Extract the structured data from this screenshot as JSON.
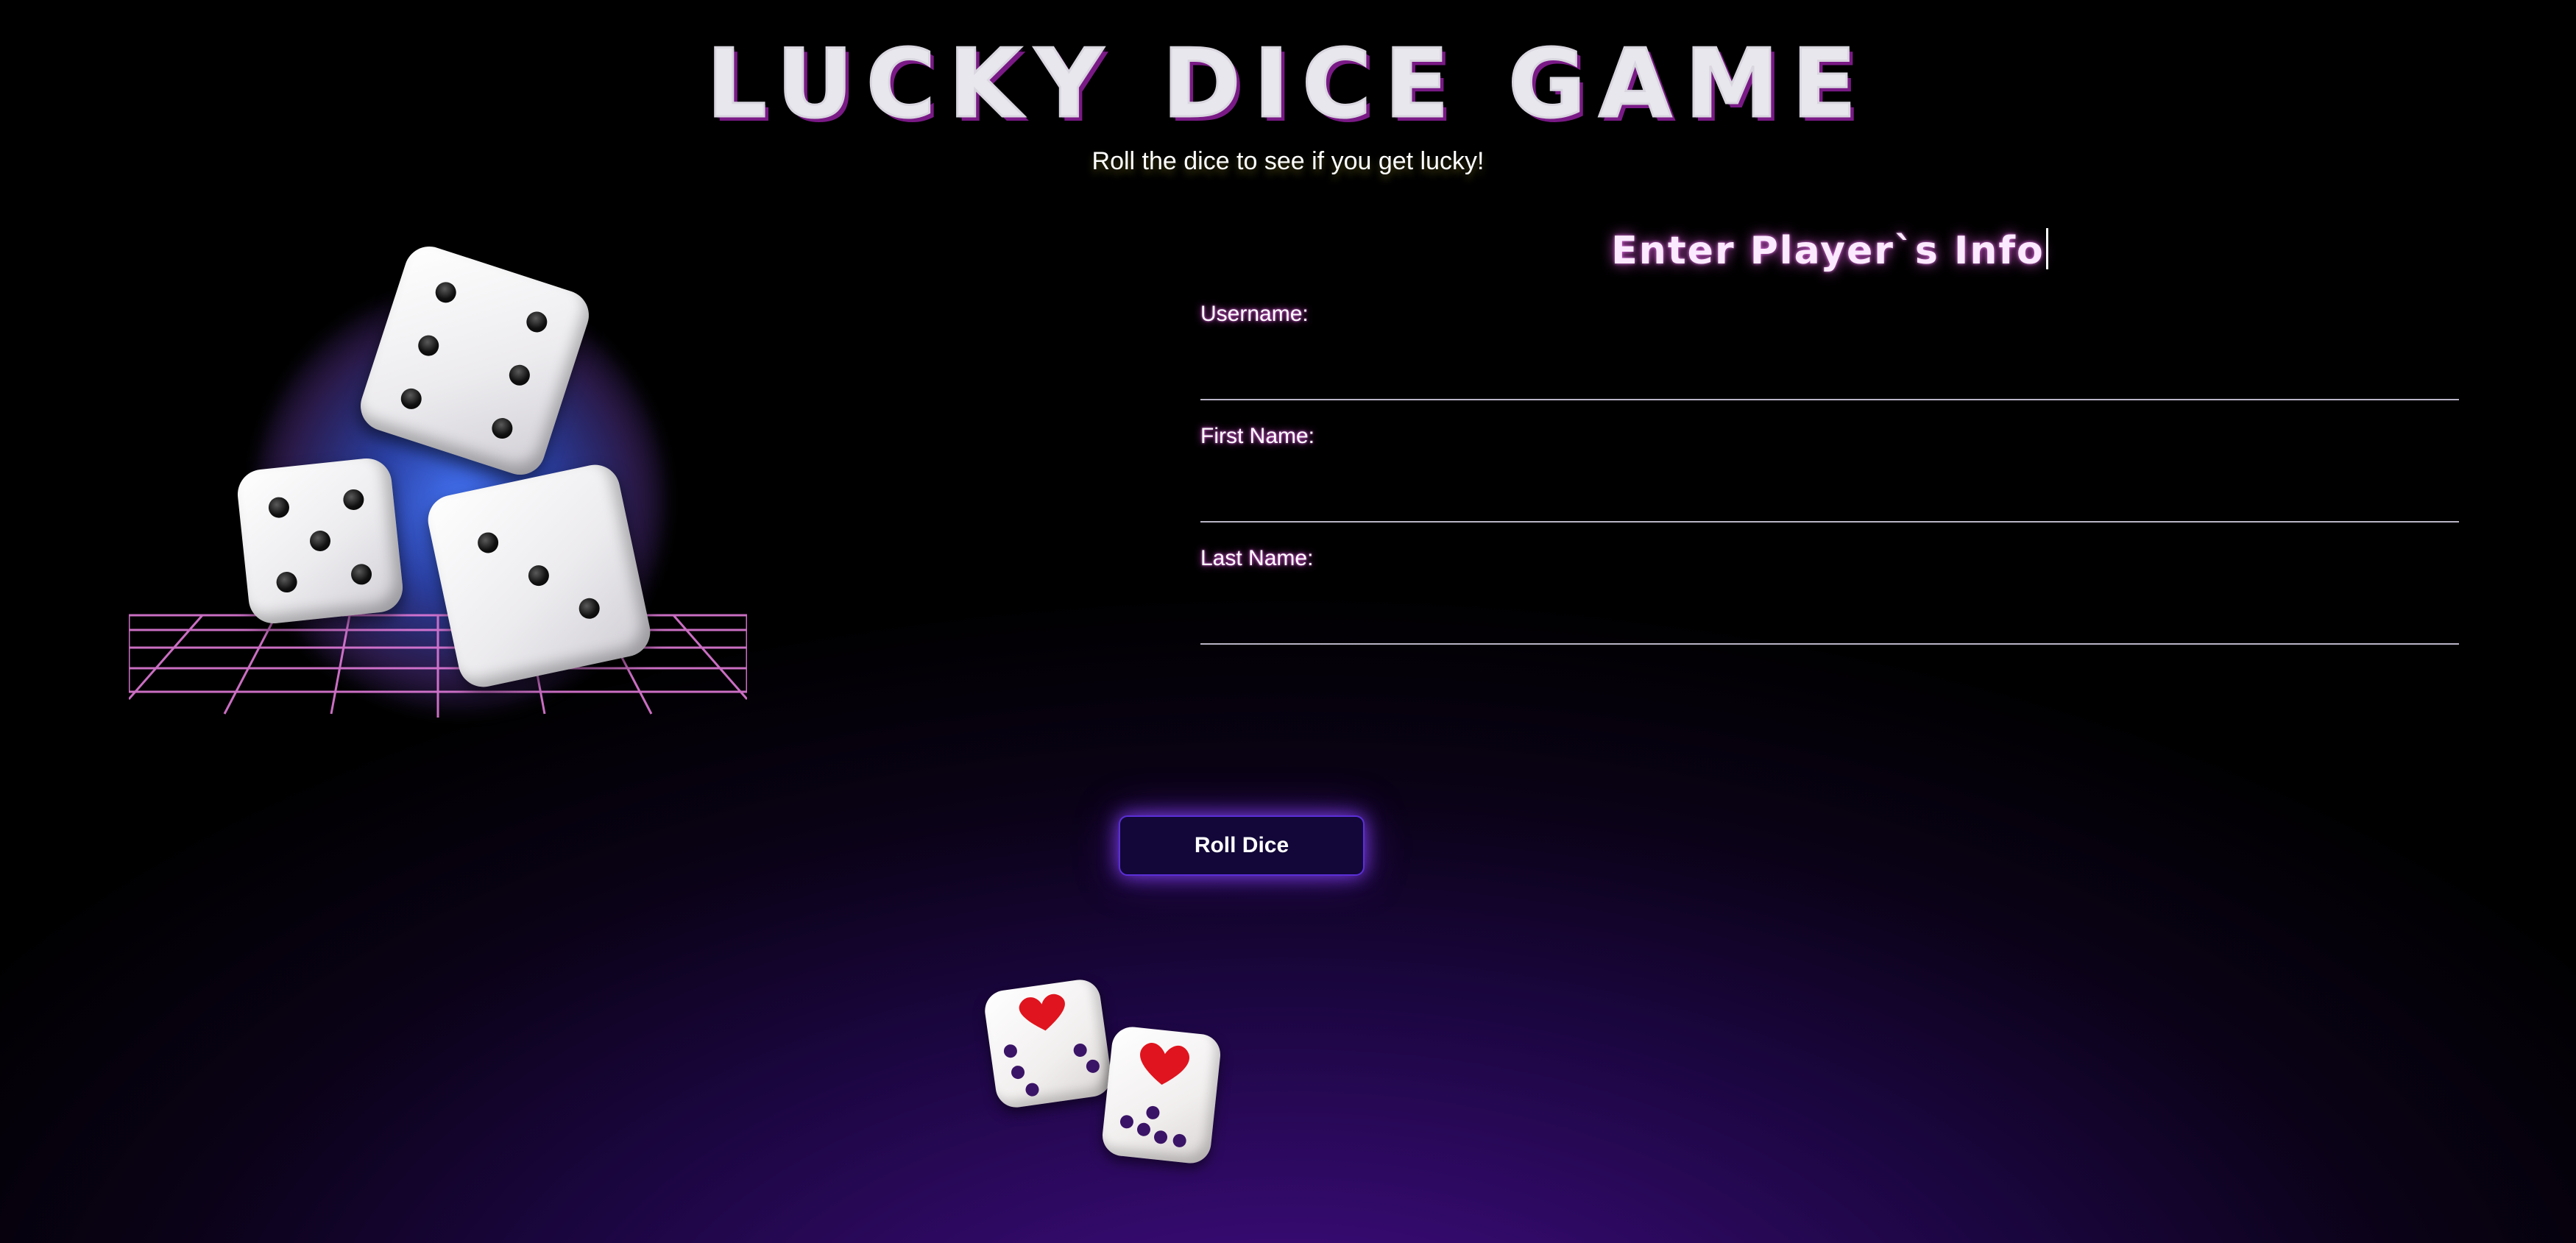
{
  "header": {
    "title": "LUCKY DICE GAME",
    "subtitle": "Roll the dice to see if you get lucky!"
  },
  "form": {
    "heading": "Enter Player`s Info",
    "fields": [
      {
        "label": "Username:",
        "value": ""
      },
      {
        "label": "First Name:",
        "value": ""
      },
      {
        "label": "Last Name:",
        "value": ""
      }
    ],
    "submit_label": "Roll Dice"
  },
  "colors": {
    "background_top": "#000000",
    "background_bottom": "#4a0f8c",
    "accent_glow": "#e05ae0",
    "button_border": "#5a2fd6",
    "grid": "#e07ad8",
    "small_dice_heart": "#e0141e"
  },
  "images": {
    "hero": "three-white-dice-on-neon-grid",
    "result_dice": "two-small-dice-with-heart-faces"
  }
}
